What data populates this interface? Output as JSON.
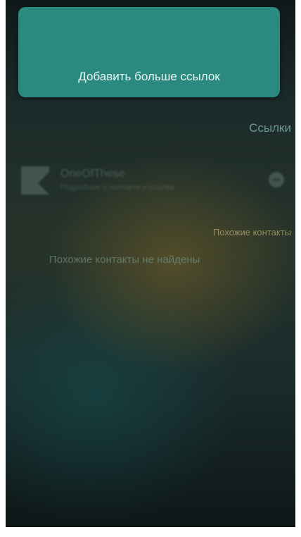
{
  "add_links_button": {
    "label": "Добавить больше ссылок"
  },
  "links_section": {
    "title": "Ссылки",
    "items": [
      {
        "title": "OneOfThese",
        "subtitle": "Подробнее о контакте и ссылке"
      }
    ]
  },
  "similar_section": {
    "title": "Похожие контакты",
    "empty_text": "Похожие контакты не найдены"
  },
  "colors": {
    "accent": "#2b8a80",
    "section_title": "#7fb5b0",
    "similar_title": "#a89b6a"
  }
}
